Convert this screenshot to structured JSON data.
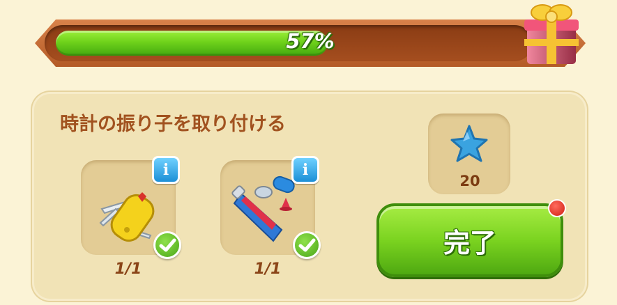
{
  "progress": {
    "label": "57%",
    "percent": 57
  },
  "task": {
    "title": "時計の振り子を取り付ける",
    "items": [
      {
        "icon": "pocket-knife-icon",
        "count": "1/1",
        "complete": true
      },
      {
        "icon": "glue-tube-icon",
        "count": "1/1",
        "complete": true
      }
    ]
  },
  "reward": {
    "icon": "blue-star-icon",
    "value": "20"
  },
  "done_button": {
    "label": "完了"
  },
  "colors": {
    "accent_green": "#7bd320",
    "frame_brown": "#b35a26",
    "info_blue": "#1c8fd6"
  }
}
